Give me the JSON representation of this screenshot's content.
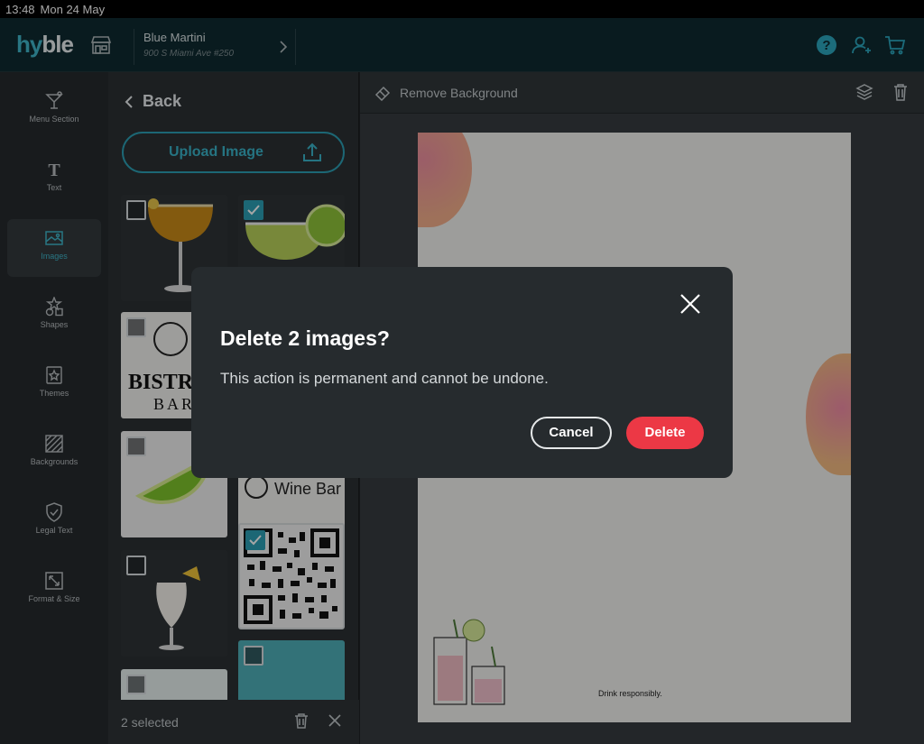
{
  "status": {
    "time": "13:48",
    "date": "Mon 24 May"
  },
  "brand": {
    "logo_a": "hy",
    "logo_b": "ble",
    "accent": "#3fb6c9"
  },
  "venue": {
    "name": "Blue Martini",
    "address": "900 S Miami Ave #250"
  },
  "header_icons": [
    "help-icon",
    "account-icon",
    "cart-icon"
  ],
  "nav": {
    "items": [
      {
        "label": "Menu Section",
        "icon": "cocktail-icon"
      },
      {
        "label": "Text",
        "icon": "text-icon"
      },
      {
        "label": "Images",
        "icon": "image-icon",
        "active": true
      },
      {
        "label": "Shapes",
        "icon": "shapes-icon"
      },
      {
        "label": "Themes",
        "icon": "themes-icon"
      },
      {
        "label": "Backgrounds",
        "icon": "backgrounds-icon"
      },
      {
        "label": "Legal Text",
        "icon": "legal-icon"
      },
      {
        "label": "Format & Size",
        "icon": "resize-icon"
      }
    ]
  },
  "panel": {
    "back_label": "Back",
    "upload_label": "Upload Image",
    "selected_text": "2 selected",
    "bistro_line1": "BISTR",
    "bistro_line2": "BAR",
    "wine_text": "Wine Bar"
  },
  "toolbar": {
    "remove_bg_label": "Remove Background"
  },
  "canvas": {
    "footer_text": "Drink responsibly."
  },
  "dialog": {
    "title": "Delete 2 images?",
    "message": "This action is permanent and cannot be undone.",
    "cancel_label": "Cancel",
    "delete_label": "Delete",
    "delete_color": "#ec3845"
  }
}
